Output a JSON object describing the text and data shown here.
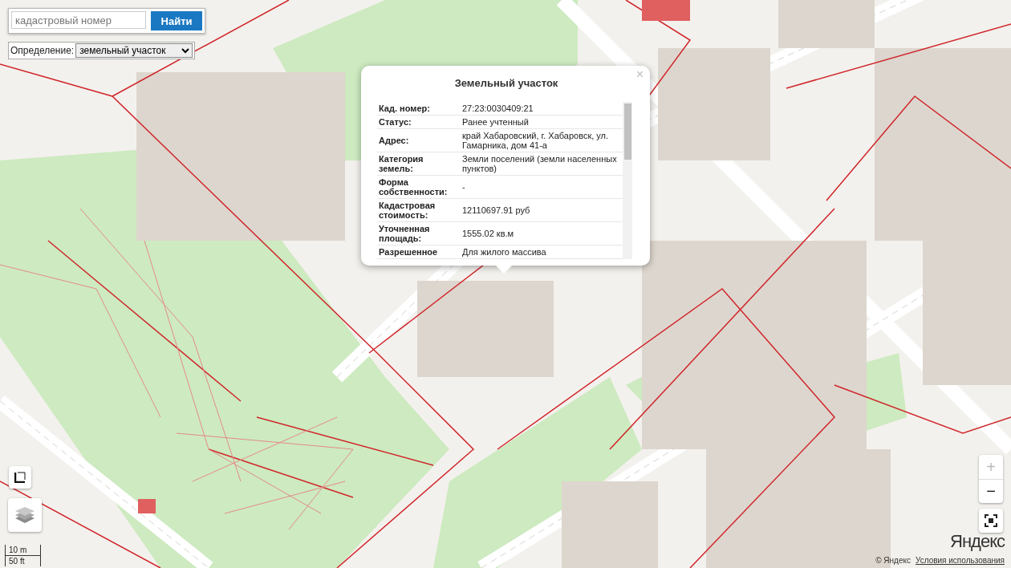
{
  "search": {
    "placeholder": "кадастровый номер",
    "button": "Найти"
  },
  "definition": {
    "label": "Определение:",
    "value": "земельный участок"
  },
  "popup": {
    "title": "Земельный участок",
    "close": "×",
    "rows": [
      {
        "label": "Кад. номер:",
        "value": "27:23:0030409:21"
      },
      {
        "label": "Статус:",
        "value": "Ранее учтенный"
      },
      {
        "label": "Адрес:",
        "value": "край Хабаровский, г. Хабаровск, ул. Гамарника, дом 41-а"
      },
      {
        "label": "Категория земель:",
        "value": "Земли поселений (земли населенных пунктов)"
      },
      {
        "label": "Форма собственности:",
        "value": "-"
      },
      {
        "label": "Кадастровая стоимость:",
        "value": "12110697.91 руб"
      },
      {
        "label": "Уточненная площадь:",
        "value": "1555.02 кв.м"
      },
      {
        "label": "Разрешенное",
        "value": "Для жилого массива"
      }
    ]
  },
  "zoom": [
    {
      "kind": "in",
      "label": "+",
      "disabled": true
    },
    {
      "kind": "out",
      "label": "−",
      "disabled": false
    }
  ],
  "scale": {
    "metric": "10 m",
    "imperial": "50 ft"
  },
  "logo": "Яндекс",
  "copyright": "© Яндекс",
  "terms_link": "Условия использования"
}
